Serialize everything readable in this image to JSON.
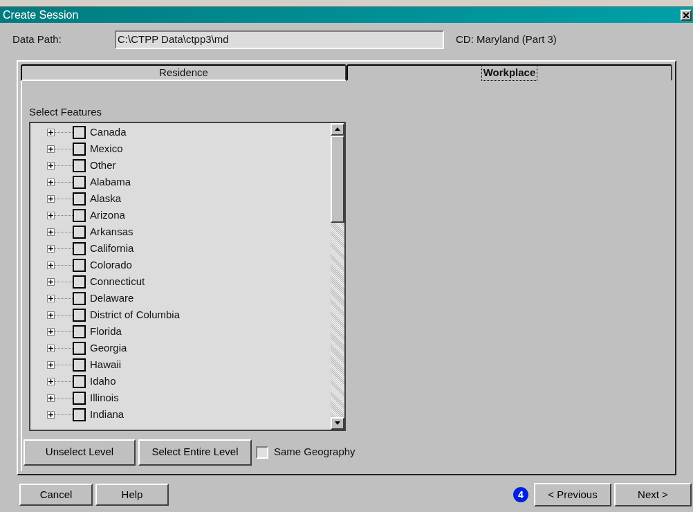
{
  "window": {
    "title": "Create Session"
  },
  "data_path": {
    "label": "Data Path:",
    "value": "C:\\CTPP Data\\ctpp3\\md"
  },
  "cd_label": "CD: Maryland (Part 3)",
  "tabs": [
    {
      "label": "Residence",
      "selected": false
    },
    {
      "label": "Workplace",
      "selected": true
    }
  ],
  "select_features_label": "Select Features",
  "tree": [
    {
      "label": "Canada",
      "expanded": false,
      "checked": false
    },
    {
      "label": "Mexico",
      "expanded": false,
      "checked": false
    },
    {
      "label": "Other",
      "expanded": false,
      "checked": false
    },
    {
      "label": "Alabama",
      "expanded": false,
      "checked": false
    },
    {
      "label": "Alaska",
      "expanded": false,
      "checked": false
    },
    {
      "label": "Arizona",
      "expanded": false,
      "checked": false
    },
    {
      "label": "Arkansas",
      "expanded": false,
      "checked": false
    },
    {
      "label": "California",
      "expanded": false,
      "checked": false
    },
    {
      "label": "Colorado",
      "expanded": false,
      "checked": false
    },
    {
      "label": "Connecticut",
      "expanded": false,
      "checked": false
    },
    {
      "label": "Delaware",
      "expanded": false,
      "checked": false
    },
    {
      "label": "District of Columbia",
      "expanded": false,
      "checked": false
    },
    {
      "label": "Florida",
      "expanded": false,
      "checked": false
    },
    {
      "label": "Georgia",
      "expanded": false,
      "checked": false
    },
    {
      "label": "Hawaii",
      "expanded": false,
      "checked": false
    },
    {
      "label": "Idaho",
      "expanded": false,
      "checked": false
    },
    {
      "label": "Illinois",
      "expanded": false,
      "checked": false
    },
    {
      "label": "Indiana",
      "expanded": false,
      "checked": false
    }
  ],
  "level_buttons": [
    "Unselect Level",
    "Select Entire Level"
  ],
  "same_geography": {
    "label": "Same Geography",
    "checked": false
  },
  "footer_left_buttons": [
    "Cancel",
    "Help"
  ],
  "step_badge": "4",
  "nav_buttons": [
    "< Previous",
    "Next >"
  ]
}
